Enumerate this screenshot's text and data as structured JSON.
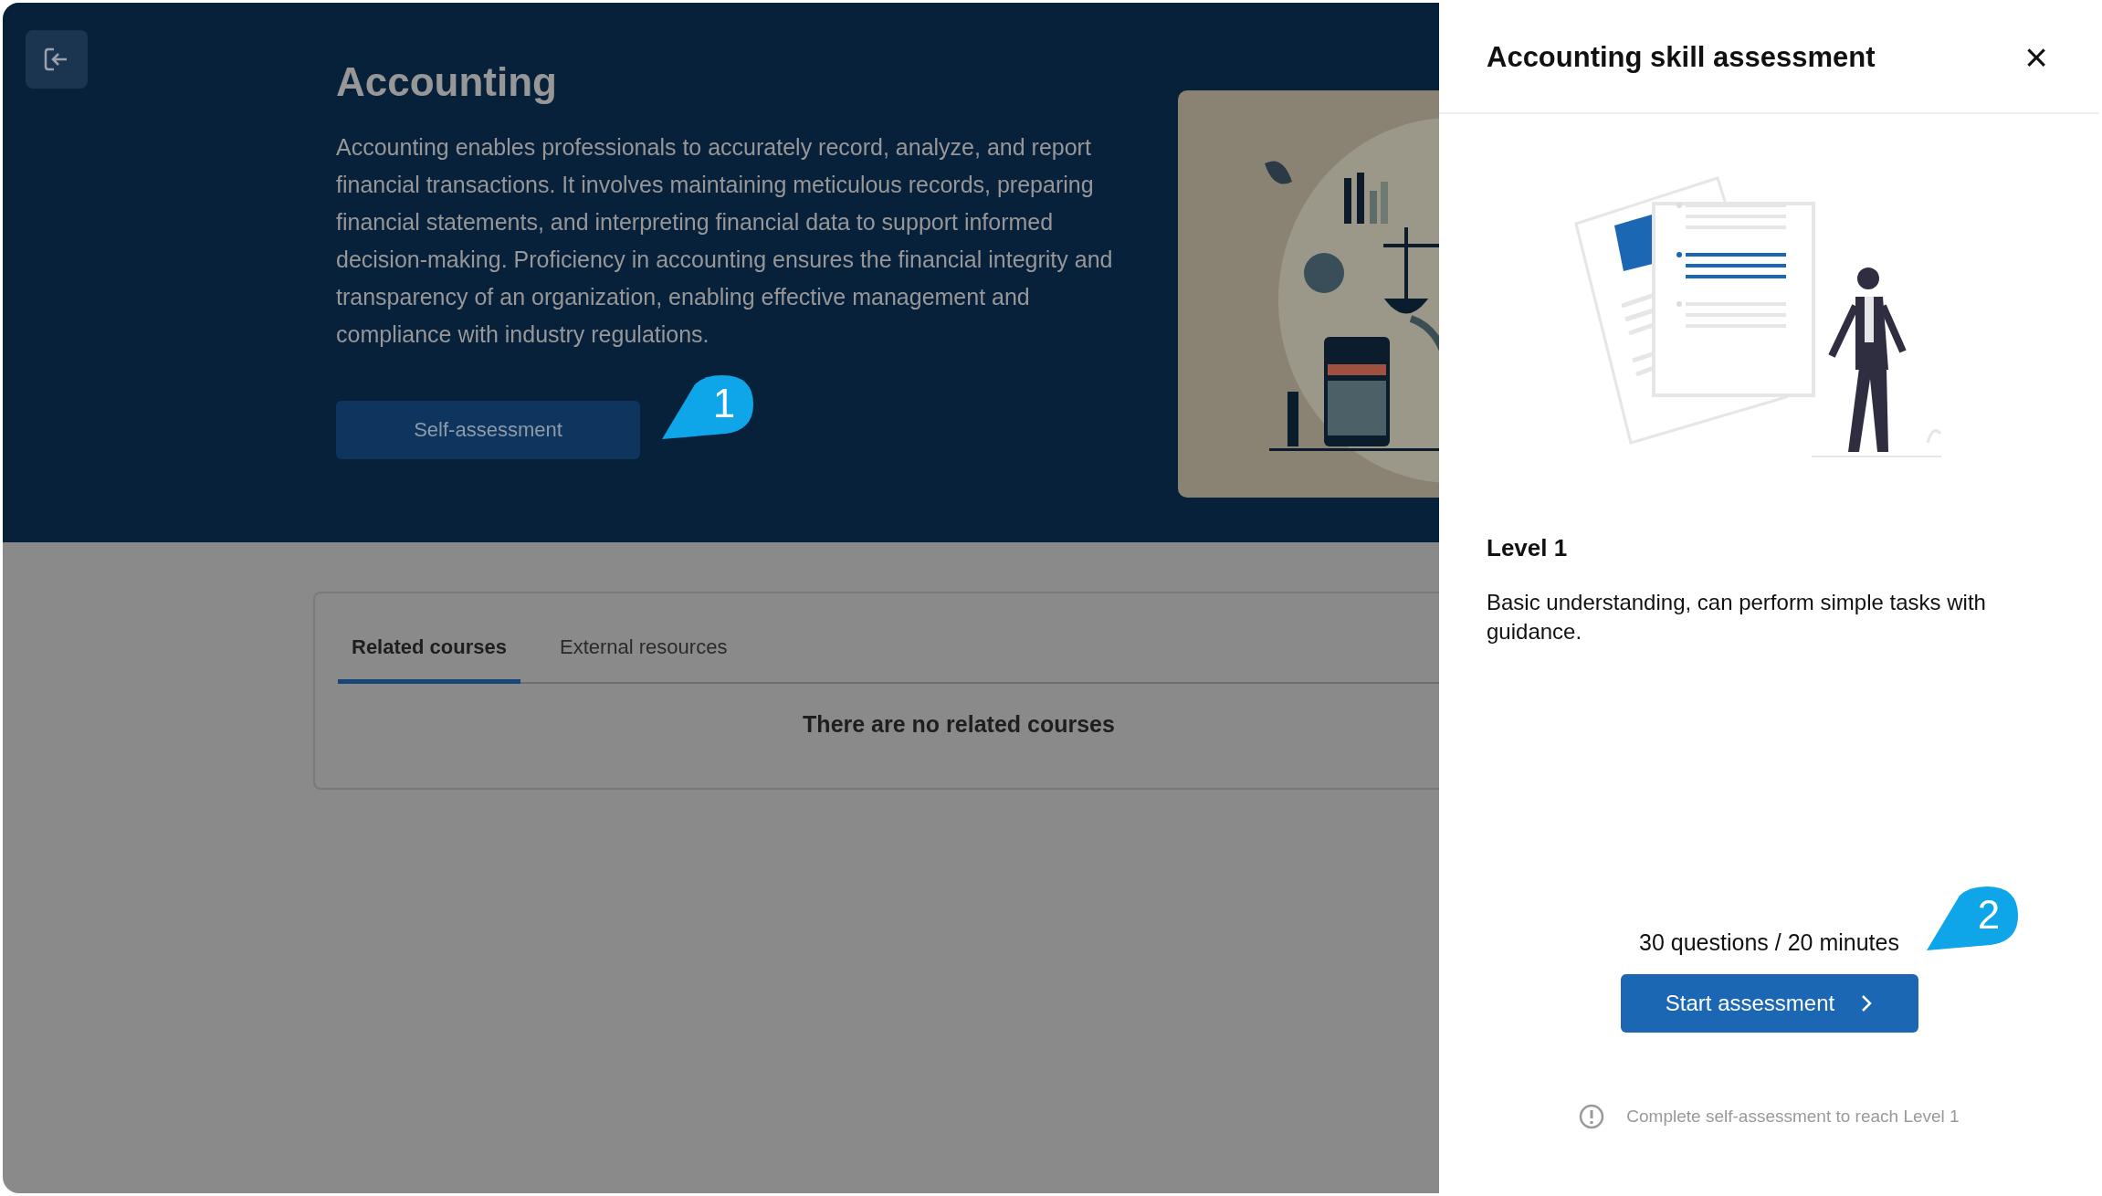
{
  "hero": {
    "title": "Accounting",
    "description": "Accounting enables professionals to accurately record, analyze, and report financial transactions. It involves maintaining meticulous records, preparing financial statements, and interpreting financial data to support informed decision-making. Proficiency in accounting ensures the financial integrity and transparency of an organization, enabling effective management and compliance with industry regulations.",
    "button": "Self-assessment"
  },
  "tabs": [
    {
      "label": "Related courses",
      "selected": true
    },
    {
      "label": "External resources",
      "selected": false
    }
  ],
  "empty_message": "There are no related courses",
  "panel": {
    "title": "Accounting skill assessment",
    "close": "×",
    "level_title": "Level 1",
    "level_description": "Basic understanding, can perform simple tasks with guidance.",
    "meta": "30 questions / 20 minutes",
    "button": "Start assessment",
    "note": "Complete self-assessment to reach Level 1"
  },
  "callouts": [
    {
      "label": "1"
    },
    {
      "label": "2"
    }
  ]
}
